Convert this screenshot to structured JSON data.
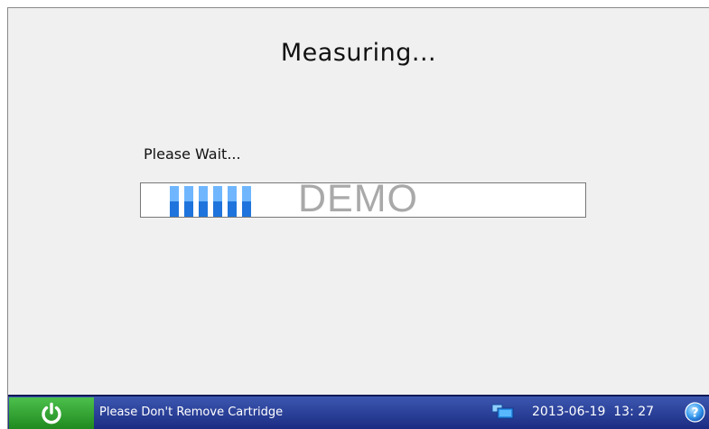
{
  "screen": {
    "title": "Measuring...",
    "wait_label": "Please Wait...",
    "progress": {
      "filled_segments": 6,
      "watermark": "DEMO"
    }
  },
  "statusbar": {
    "power_icon": "power-icon",
    "message": "Please Don't Remove Cartridge",
    "monitor_icon": "monitor-icon",
    "datetime": "2013-06-19  13: 27",
    "help_icon": "help-icon"
  },
  "colors": {
    "background": "#f0f0f0",
    "statusbar": "#23358f",
    "power_button": "#2e9e2e",
    "progress_light": "#6fb6ff",
    "progress_dark": "#1e74dc",
    "watermark": "#a9a9a9"
  }
}
